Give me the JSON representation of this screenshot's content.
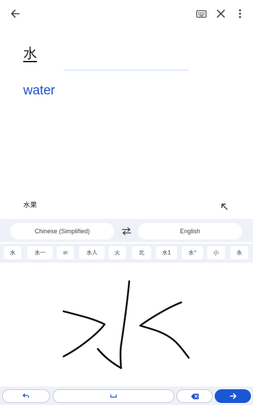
{
  "header": {
    "back_icon": "arrow-left-icon",
    "keyboard_icon": "keyboard-icon",
    "close_icon": "close-icon",
    "menu_icon": "more-vert-icon"
  },
  "source": {
    "text": "水"
  },
  "translation": {
    "text": "water",
    "color": "#1a4fc9"
  },
  "suggestion": {
    "text": "水果",
    "icon": "arrow-up-left-icon"
  },
  "languages": {
    "source": "Chinese (Simplified)",
    "target": "English",
    "swap_icon": "swap-icon"
  },
  "candidates": [
    "水",
    "水一",
    "氺",
    "水人",
    "火",
    "北",
    "水1",
    "水°",
    "小",
    "永"
  ],
  "bottom": {
    "undo_icon": "undo-icon",
    "space_icon": "space-icon",
    "backspace_icon": "backspace-icon",
    "enter_icon": "arrow-right-icon",
    "accent": "#1a57d2"
  }
}
